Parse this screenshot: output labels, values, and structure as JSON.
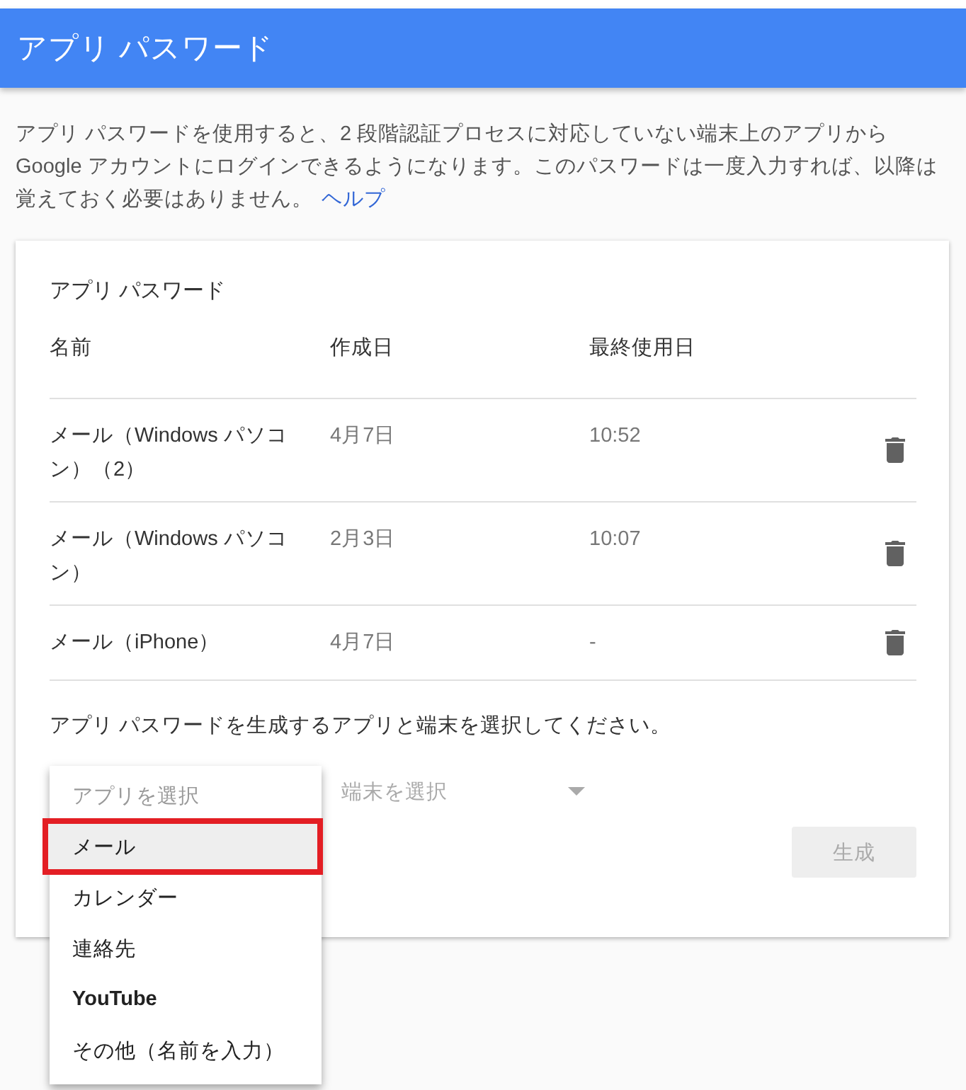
{
  "header": {
    "title": "アプリ パスワード"
  },
  "description": {
    "lines": [
      "アプリ パスワードを使用すると、2 段階認証プロセスに対応していない端末上のアプリから",
      "Google アカウントにログインできるようになります。このパスワードは一度入力すれば、以降は",
      "覚えておく必要はありません。"
    ],
    "help_link": "ヘルプ"
  },
  "card": {
    "title": "アプリ パスワード",
    "columns": [
      "名前",
      "作成日",
      "最終使用日"
    ],
    "rows": [
      {
        "name": "メール（Windows パソコン）（2）",
        "created": "4月7日",
        "last_used": "10:52"
      },
      {
        "name": "メール（Windows パソコン）",
        "created": "2月3日",
        "last_used": "10:07"
      },
      {
        "name": "メール（iPhone）",
        "created": "4月7日",
        "last_used": "-"
      }
    ],
    "instruction": "アプリ パスワードを生成するアプリと端末を選択してください。",
    "app_select": {
      "placeholder": "アプリを選択",
      "expanded": true
    },
    "device_select": {
      "placeholder": "端末を選択"
    },
    "generate_button": {
      "label": "生成",
      "disabled": true
    }
  },
  "app_menu": {
    "items": [
      {
        "label": "メール",
        "selected": true,
        "outlined": true,
        "bold": false
      },
      {
        "label": "カレンダー",
        "selected": false,
        "outlined": false,
        "bold": false
      },
      {
        "label": "連絡先",
        "selected": false,
        "outlined": false,
        "bold": false
      },
      {
        "label": "YouTube",
        "selected": false,
        "outlined": false,
        "bold": true
      },
      {
        "label": "その他（名前を入力）",
        "selected": false,
        "outlined": false,
        "bold": false
      }
    ]
  }
}
